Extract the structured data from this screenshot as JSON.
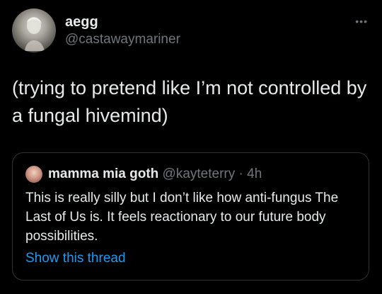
{
  "author": {
    "name": "aegg",
    "handle": "@castawaymariner",
    "avatar_icon": "avatar-photo"
  },
  "menu_icon": "more-options-icon",
  "tweet": {
    "text": "(trying to pretend like I’m not controlled by a fungal hivemind)"
  },
  "quote": {
    "name": "mamma mia goth",
    "handle": "@kayteterry",
    "separator": " · ",
    "time": "4h",
    "text": "This is really silly but I don’t like how anti-fungus The Last of Us is. It feels reactionary to our future body possibilities.",
    "show_thread": "Show this thread"
  },
  "colors": {
    "background": "#000000",
    "text": "#e7e9ea",
    "secondary_text": "#71767b",
    "link": "#1d9bf0",
    "border": "#2f3336"
  }
}
